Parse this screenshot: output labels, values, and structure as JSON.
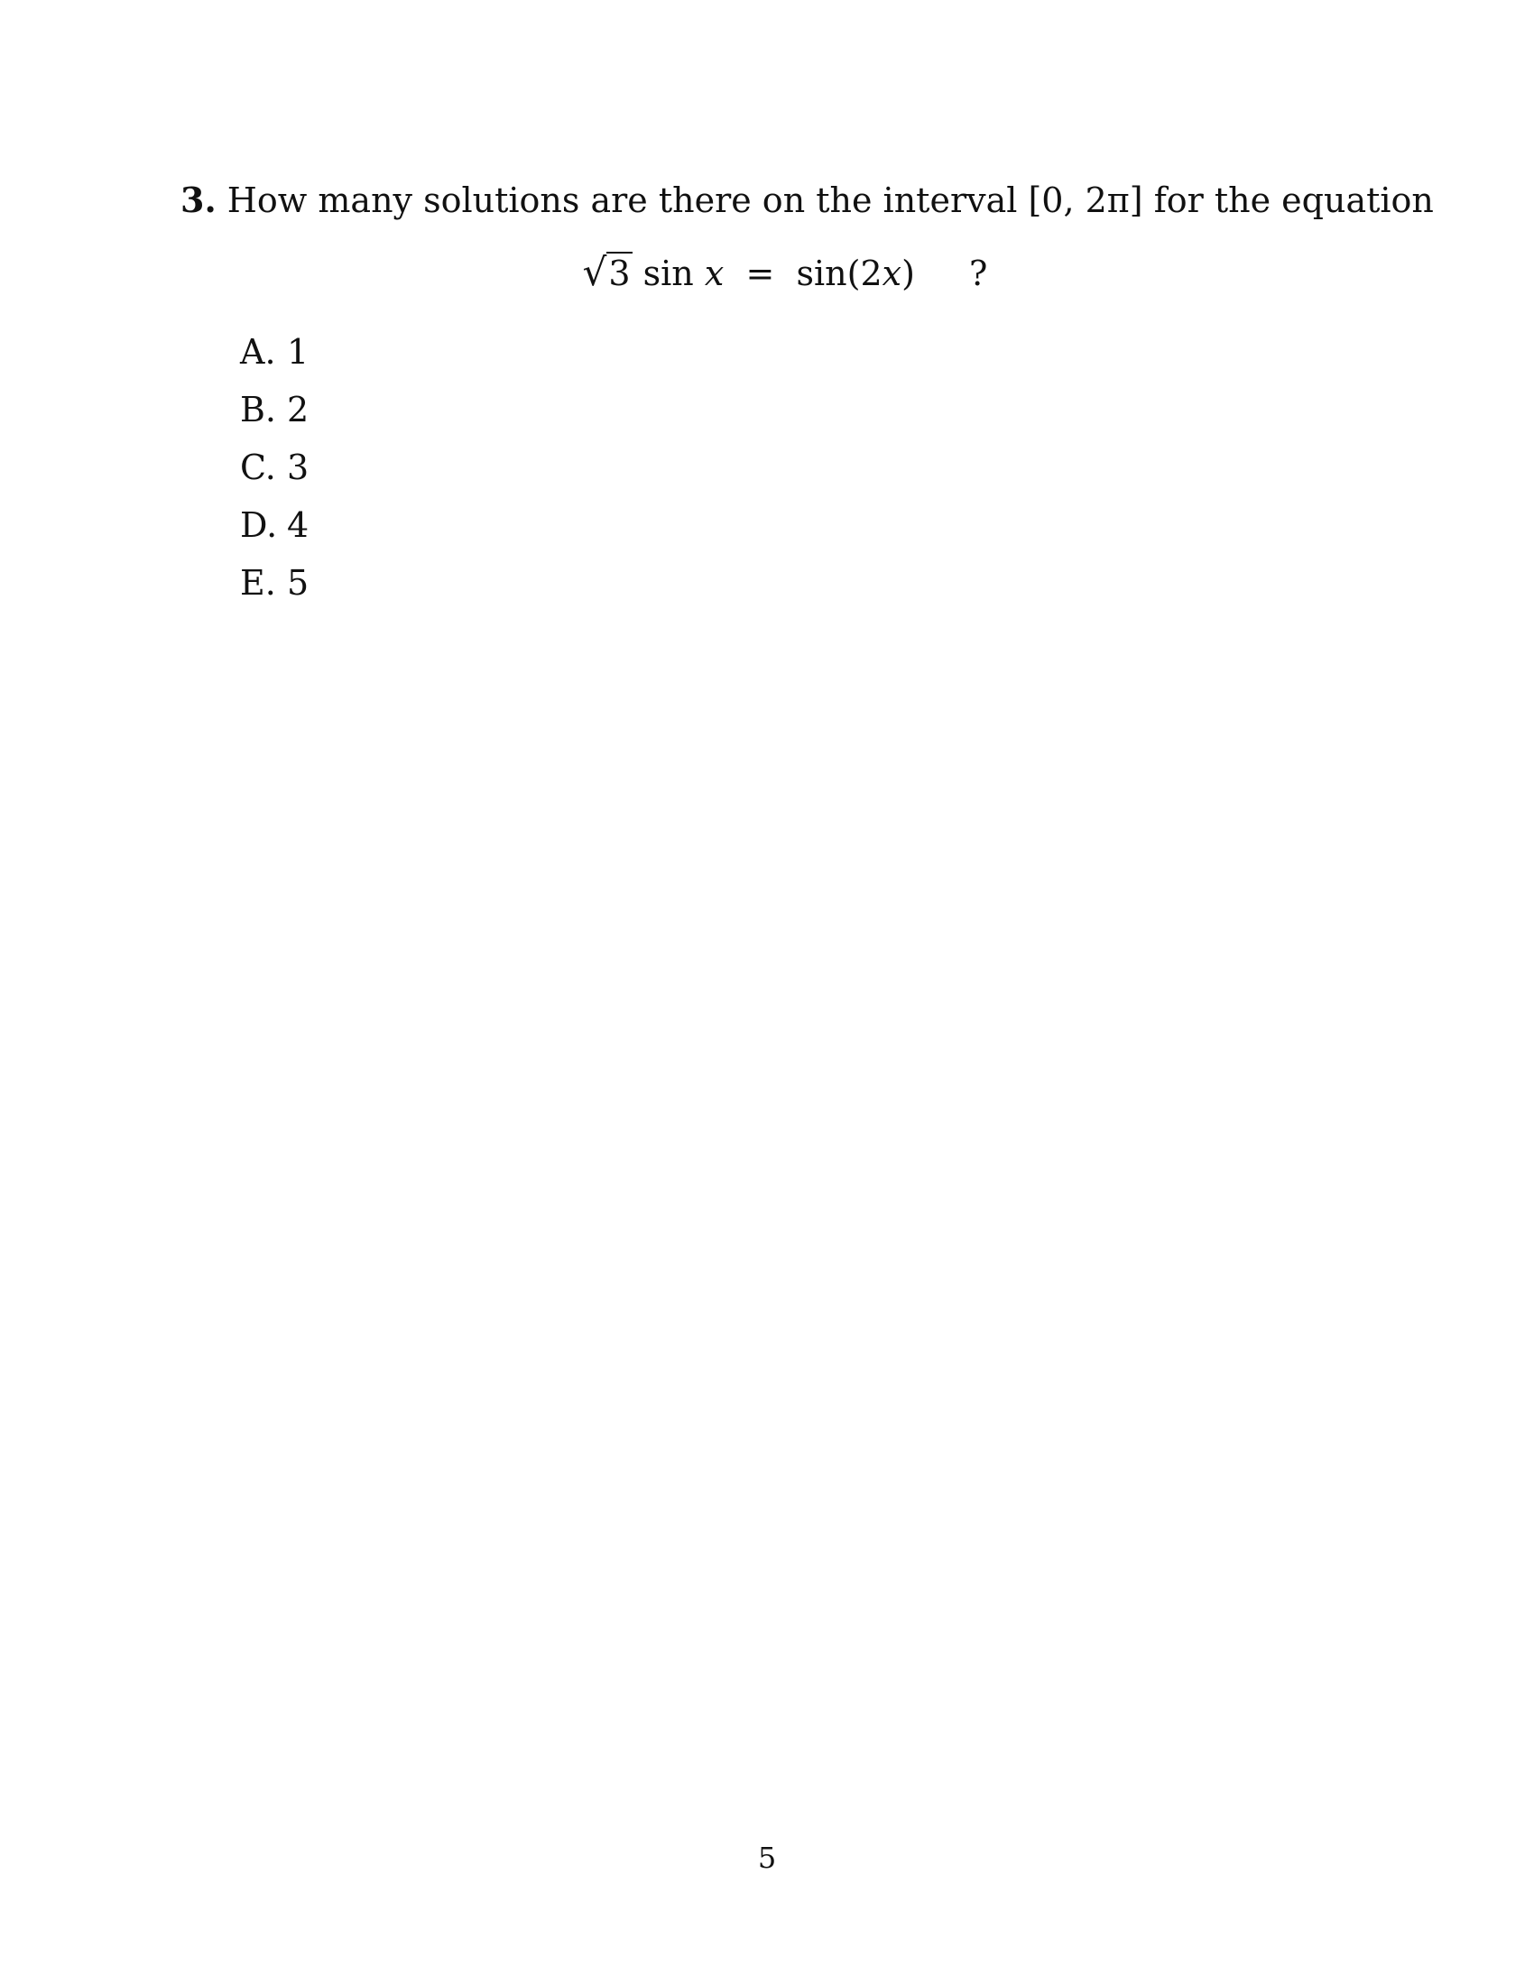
{
  "question": {
    "number": "3.",
    "text_before": "How many solutions are there on the interval ",
    "interval": "[0, 2π]",
    "text_after": " for the equation"
  },
  "equation": {
    "sqrt_sign": "√",
    "sqrt_arg": "3",
    "sin": "sin",
    "var_x": "x",
    "equals": "=",
    "rhs_func": "sin(2",
    "rhs_var": "x",
    "rhs_close": ")",
    "question_mark": "?"
  },
  "choices": [
    {
      "letter": "A.",
      "value": "1"
    },
    {
      "letter": "B.",
      "value": "2"
    },
    {
      "letter": "C.",
      "value": "3"
    },
    {
      "letter": "D.",
      "value": "4"
    },
    {
      "letter": "E.",
      "value": "5"
    }
  ],
  "page_number": "5"
}
